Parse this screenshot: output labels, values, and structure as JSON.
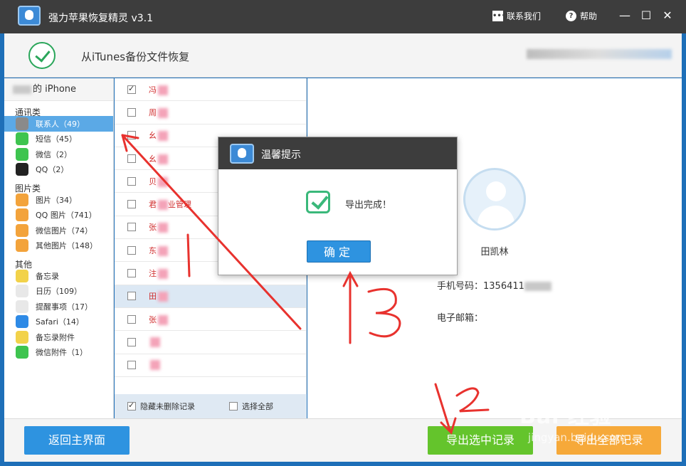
{
  "app": {
    "title": "强力苹果恢复精灵 v3.1",
    "contact_us": "联系我们",
    "help": "帮助",
    "minimize": "—",
    "maximize": "☐",
    "close": "✕"
  },
  "header": {
    "title": "从iTunes备份文件恢复"
  },
  "sidebar": {
    "device_name": "的 iPhone",
    "groups": [
      {
        "label": "通讯类",
        "items": [
          {
            "label": "联系人（49）",
            "active": true,
            "icon": "contacts-icon",
            "color": "#8a8a8a"
          },
          {
            "label": "短信（45）",
            "icon": "messages-icon",
            "color": "#3ec44f"
          },
          {
            "label": "微信（2）",
            "icon": "wechat-icon",
            "color": "#3ec44f"
          },
          {
            "label": "QQ（2）",
            "icon": "qq-icon",
            "color": "#222222"
          }
        ]
      },
      {
        "label": "图片类",
        "items": [
          {
            "label": "图片（34）",
            "icon": "photos-icon",
            "color": "#f3a33b"
          },
          {
            "label": "QQ 图片（741）",
            "icon": "qq-photos-icon",
            "color": "#f3a33b"
          },
          {
            "label": "微信图片（74）",
            "icon": "wechat-photos-icon",
            "color": "#f3a33b"
          },
          {
            "label": "其他图片（148）",
            "icon": "other-photos-icon",
            "color": "#f3a33b"
          }
        ]
      },
      {
        "label": "其他",
        "items": [
          {
            "label": "备忘录",
            "icon": "notes-icon",
            "color": "#f2d24a"
          },
          {
            "label": "日历（109）",
            "icon": "calendar-icon",
            "color": "#e8e8e8"
          },
          {
            "label": "提醒事项（17）",
            "icon": "reminders-icon",
            "color": "#e8e8e8"
          },
          {
            "label": "Safari（14）",
            "icon": "safari-icon",
            "color": "#2e8ae6"
          },
          {
            "label": "备忘录附件",
            "icon": "notes-attachment-icon",
            "color": "#f2d24a"
          },
          {
            "label": "微信附件（1）",
            "icon": "wechat-attachment-icon",
            "color": "#3ec44f"
          }
        ]
      }
    ]
  },
  "list": {
    "rows": [
      {
        "name": "冯",
        "checked": true
      },
      {
        "name": "周",
        "checked": false
      },
      {
        "name": "幺",
        "checked": false
      },
      {
        "name": "幺",
        "checked": false
      },
      {
        "name": "贝",
        "checked": false
      },
      {
        "name": "君",
        "suffix": "业管理",
        "checked": false
      },
      {
        "name": "张",
        "checked": false
      },
      {
        "name": "东",
        "checked": false
      },
      {
        "name": "注",
        "checked": false
      },
      {
        "name": "田",
        "checked": false,
        "selected": true
      },
      {
        "name": "张",
        "checked": false
      },
      {
        "name": "",
        "checked": false
      },
      {
        "name": "",
        "checked": false
      }
    ],
    "hide_undeleted": "隐藏未删除记录",
    "select_all": "选择全部"
  },
  "detail": {
    "name": "田凯林",
    "phone_label": "手机号码：",
    "phone_value": "1356411",
    "email_label": "电子邮箱："
  },
  "buttons": {
    "home": "返回主界面",
    "export_selected": "导出选中记录",
    "export_all": "导出全部记录"
  },
  "dialog": {
    "title": "温馨提示",
    "message": "导出完成！",
    "ok": "确定"
  },
  "annotations": {
    "watermark": "Bai 经验",
    "watermark_url": "jingyan.baidu.com"
  }
}
